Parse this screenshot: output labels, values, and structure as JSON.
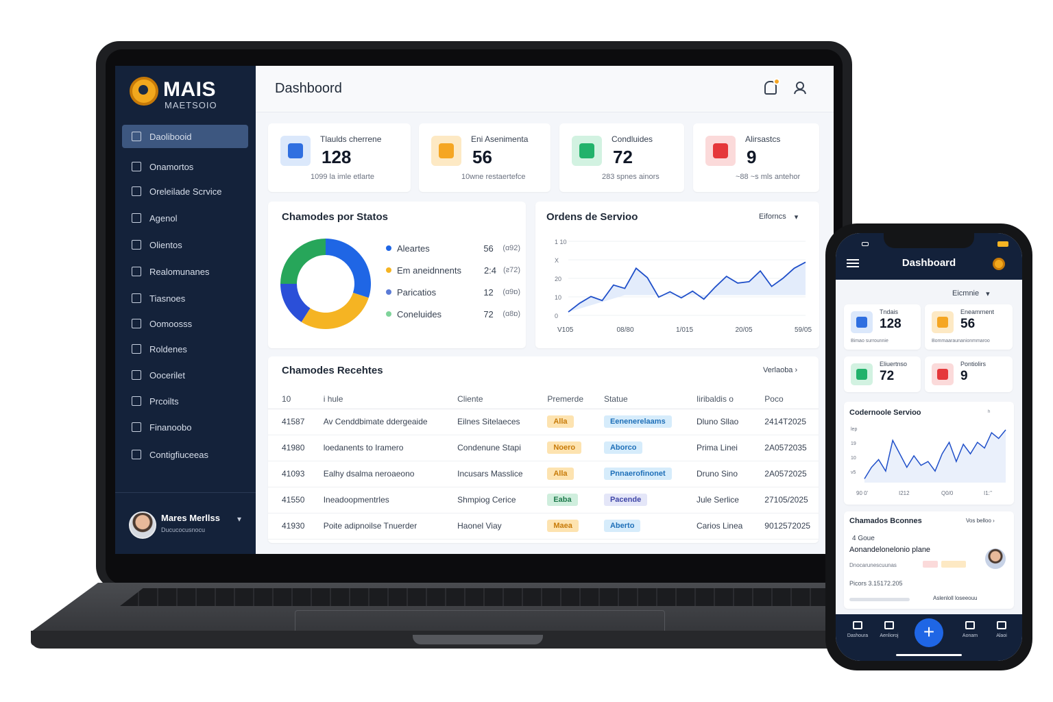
{
  "app": {
    "logo_text": "MAIS",
    "logo_sub": "MAETSOIO"
  },
  "sidebar": {
    "items": [
      {
        "label": "Daolibooid",
        "icon": "dashboard-icon"
      },
      {
        "label": "Onamortos",
        "icon": "tickets-icon"
      },
      {
        "label": "Oreleilade Scrvice",
        "icon": "service-order-icon"
      },
      {
        "label": "Agenol",
        "icon": "calendar-icon"
      },
      {
        "label": "Olientos",
        "icon": "bell-icon"
      },
      {
        "label": "Realomunanes",
        "icon": "reports-icon"
      },
      {
        "label": "Tiasnoes",
        "icon": "users-icon"
      },
      {
        "label": "Oomoosss",
        "icon": "clock-icon"
      },
      {
        "label": "Roldenes",
        "icon": "document-icon"
      },
      {
        "label": "Oocerilet",
        "icon": "folder-icon"
      },
      {
        "label": "Prcoilts",
        "icon": "products-icon"
      },
      {
        "label": "Finanoobo",
        "icon": "finance-icon"
      },
      {
        "label": "Contigfiuceeas",
        "icon": "settings-icon"
      }
    ],
    "user": {
      "name": "Mares Merllss",
      "role": "Ducucocusnocu"
    }
  },
  "header": {
    "title": "Dashboord"
  },
  "kpis": [
    {
      "label": "Tlaulds cherrene",
      "value": "128",
      "sub": "1099  la imle etlarte",
      "color": "#2f6fe0",
      "bg": "#dbe8fb",
      "icon": "ticket-icon"
    },
    {
      "label": "Eni Asenimenta",
      "value": "56",
      "sub": "10wne restaertefce",
      "color": "#f5a623",
      "bg": "#fde9c4",
      "icon": "folder-icon"
    },
    {
      "label": "Condluides",
      "value": "72",
      "sub": "283 spnes ainors",
      "color": "#22b26b",
      "bg": "#d2f2e1",
      "icon": "check-icon"
    },
    {
      "label": "Alirsastcs",
      "value": "9",
      "sub": "~88  ~s mls antehor",
      "color": "#e5383b",
      "bg": "#fbdada",
      "icon": "warning-icon"
    }
  ],
  "status_panel": {
    "title": "Chamodes por Statos",
    "legend": [
      {
        "label": "Aleartes",
        "value": "56",
        "pct": "(ɑ92)",
        "color": "#1f66e5"
      },
      {
        "label": "Em aneidnnents",
        "value": "2:4",
        "pct": "(ƨ72)",
        "color": "#f5b423"
      },
      {
        "label": "Paricatios",
        "value": "12",
        "pct": "(ɑ9ɒ)",
        "color": "#5b7bd6"
      },
      {
        "label": "Coneluides",
        "value": "72",
        "pct": "(ɑ8ɒ)",
        "color": "#7fd39a"
      }
    ]
  },
  "chart_data": {
    "type": "donut",
    "title": "Chamodes por Statos",
    "categories": [
      "Aleartes",
      "Em aneidnnents",
      "Paricatios",
      "Coneluides"
    ],
    "values": [
      30,
      29,
      16,
      25
    ],
    "colors": [
      "#1f66e5",
      "#f5b423",
      "#2b4fd8",
      "#27a65a"
    ]
  },
  "orders_panel": {
    "title": "Ordens de Servioo",
    "filter": "Eiforncs",
    "y_ticks": [
      "1 10",
      "X",
      "20",
      "10",
      "0"
    ],
    "x_ticks": [
      "V105",
      "08/80",
      "1/015",
      "20/05",
      "59/05"
    ],
    "line": [
      5,
      18,
      28,
      22,
      45,
      40,
      70,
      56,
      27,
      35,
      26,
      36,
      24,
      42,
      58,
      48,
      50,
      66,
      43,
      55,
      70,
      79
    ],
    "ymax": 110
  },
  "recent": {
    "title": "Chamodes Recehtes",
    "link": "Verlaoba",
    "columns": [
      "10",
      "i hule",
      "Cliente",
      "Premerde",
      "Statue",
      "Iiribaldis o",
      "Poco"
    ],
    "rows": [
      {
        "id": "41587",
        "title": "Av Cenddbimate ddergeaide",
        "client": "Eilnes Sitelaeces",
        "prio": "Alla",
        "prio_bg": "#fde3b0",
        "prio_fg": "#c77a08",
        "status": "Eenenerelaams",
        "st_bg": "#d6ecfb",
        "st_fg": "#1e6fb8",
        "resp": "Dluno Sllao",
        "date": "2414T2025"
      },
      {
        "id": "41980",
        "title": "loedanents to Iramero",
        "client": "Condenune Stapi",
        "prio": "Noero",
        "prio_bg": "#fde3b0",
        "prio_fg": "#c77a08",
        "status": "Aborco",
        "st_bg": "#d6ecfb",
        "st_fg": "#1e6fb8",
        "resp": "Prima Linei",
        "date": "2A0572035"
      },
      {
        "id": "41093",
        "title": "Ealhy dsalma neroaeono",
        "client": "Incusars Masslice",
        "prio": "Alla",
        "prio_bg": "#fde3b0",
        "prio_fg": "#c77a08",
        "status": "Pnnaerofinonet",
        "st_bg": "#d6ecfb",
        "st_fg": "#1e6fb8",
        "resp": "Druno Sino",
        "date": "2A0572025"
      },
      {
        "id": "41550",
        "title": "Ineadoopmentrles",
        "client": "Shmpiog Cerice",
        "prio": "Eaba",
        "prio_bg": "#cfeedd",
        "prio_fg": "#1e7a4c",
        "status": "Pacende",
        "st_bg": "#e4e6f8",
        "st_fg": "#3f46a8",
        "resp": "Jule Serlice",
        "date": "27105/2025"
      },
      {
        "id": "41930",
        "title": "Poite adipnoilse Tnuerder",
        "client": "Haonel Viay",
        "prio": "Maea",
        "prio_bg": "#fde3b0",
        "prio_fg": "#c77a08",
        "status": "Aberto",
        "st_bg": "#d6ecfb",
        "st_fg": "#1e6fb8",
        "resp": "Carios Linea",
        "date": "9012572025"
      }
    ]
  },
  "phone": {
    "title": "Dashboard",
    "filter": "Eicmnie",
    "kpis": [
      {
        "label": "Tndais",
        "value": "128",
        "sub": "Bimao surrounnie",
        "color": "#2f6fe0",
        "bg": "#dbe8fb"
      },
      {
        "label": "Eneamrnent",
        "value": "56",
        "sub": "Bommaaraunanionmmaroo",
        "color": "#f5a623",
        "bg": "#fde9c4"
      },
      {
        "label": "Eliuertnso",
        "value": "72",
        "sub": "",
        "color": "#22b26b",
        "bg": "#d2f2e1"
      },
      {
        "label": "Pontiolirs",
        "value": "9",
        "sub": "",
        "color": "#e5383b",
        "bg": "#fbdada"
      }
    ],
    "chart_title": "Codernoole Servioo",
    "chart_marker": "ʰ",
    "chart_y": [
      "lep",
      "19",
      "10",
      "v5"
    ],
    "chart_x": [
      "90 0’",
      "I212",
      "Q0/0",
      "I1:’’"
    ],
    "chart_line": [
      4,
      16,
      24,
      12,
      44,
      30,
      16,
      28,
      18,
      22,
      12,
      30,
      42,
      22,
      40,
      30,
      42,
      36,
      52,
      46,
      55
    ],
    "recent_title": "Chamados Bconnes",
    "recent_link": "Vos belloo ›",
    "item_id": "4 Goue",
    "item_title": "Aonandelonelonio plane",
    "item_sub": "Dnocarunescuunas",
    "item_date": "Picors 3.15172.205",
    "footer_text": "Aslenloll loseeouu",
    "nav": [
      {
        "label": "Dashoura",
        "icon": "home-icon"
      },
      {
        "label": "Aenlioroj",
        "icon": "tickets-icon"
      },
      {
        "label": "Aonam",
        "icon": "calendar-icon"
      },
      {
        "label": "Alaoi",
        "icon": "menu-icon"
      }
    ]
  }
}
